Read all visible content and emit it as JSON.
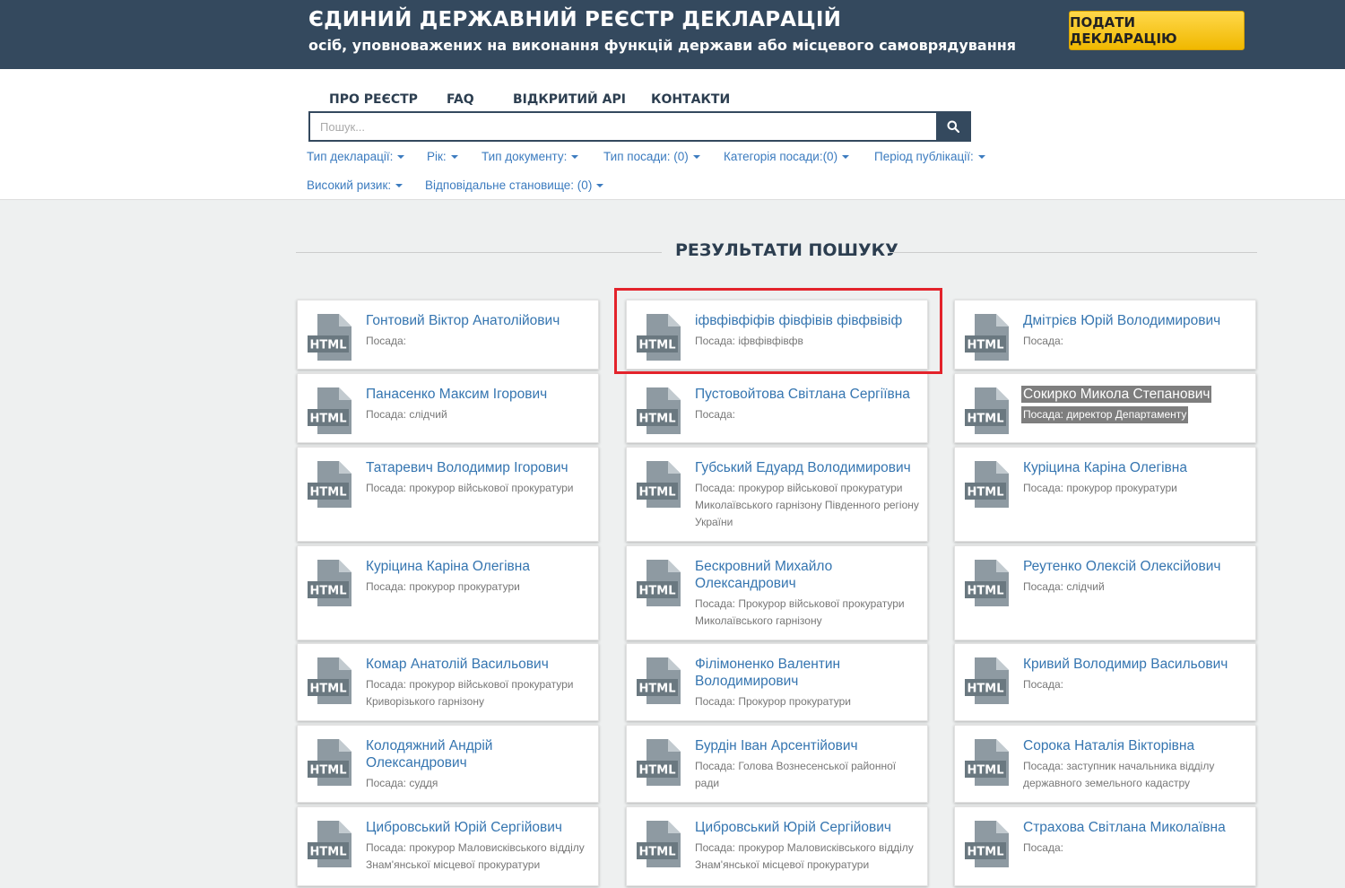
{
  "header": {
    "title": "ЄДИНИЙ ДЕРЖАВНИЙ РЕЄСТР ДЕКЛАРАЦІЙ",
    "subtitle": "осіб, уповноважених на виконання функцій держави або місцевого самоврядування",
    "submit_label": "ПОДАТИ ДЕКЛАРАЦІЮ"
  },
  "nav": [
    "ПРО РЕЄСТР",
    "FAQ",
    "ВІДКРИТИЙ API",
    "КОНТАКТИ"
  ],
  "search": {
    "placeholder": "Пошук...",
    "value": ""
  },
  "filters": [
    "Тип декларації:",
    "Рік:",
    "Тип документу:",
    "Тип посади: (0)",
    "Категорія посади:(0)",
    "Період публікації:",
    "Високий ризик:",
    "Відповідальне становище: (0)"
  ],
  "results_title": "РЕЗУЛЬТАТИ ПОШУКУ",
  "icon_label": "HTML",
  "colors": {
    "header": "#34495e",
    "accent_button": "#f5c518",
    "link": "#3575b0",
    "highlight": "#e3232b"
  },
  "cards": [
    {
      "name": "Гонтовий Віктор Анатолійович",
      "position": "Посада:"
    },
    {
      "name": "іфвфівфіфів фівфівів фівфвівіф",
      "position": "Посада: іфвфівфівфв"
    },
    {
      "name": "Дмітрієв Юрій Володимирович",
      "position": "Посада:"
    },
    {
      "name": "Панасенко Максим Ігорович",
      "position": "Посада: слідчий"
    },
    {
      "name": "Пустовойтова Світлана Сергіївна",
      "position": "Посада:"
    },
    {
      "name": "Сокирко Микола Степанович",
      "position": "Посада: директор Департаменту"
    },
    {
      "name": "Татаревич Володимир Ігорович",
      "position": "Посада: прокурор військової прокуратури"
    },
    {
      "name": "Губський Едуард Володимирович",
      "position": "Посада: прокурор військової прокуратури Миколаївського гарнізону Південного регіону України"
    },
    {
      "name": "Куріцина Каріна Олегівна",
      "position": "Посада: прокурор прокуратури"
    },
    {
      "name": "Куріцина Каріна Олегівна",
      "position": "Посада: прокурор прокуратури"
    },
    {
      "name": "Бескровний Михайло Олександрович",
      "position": "Посада: Прокурор військової прокуратури Миколаївського гарнізону"
    },
    {
      "name": "Реутенко Олексій Олексійович",
      "position": "Посада: слідчий"
    },
    {
      "name": "Комар Анатолій Васильович",
      "position": "Посада: прокурор військової прокуратури Криворізького гарнізону"
    },
    {
      "name": "Філімоненко Валентин Володимирович",
      "position": "Посада: Прокурор прокуратури"
    },
    {
      "name": "Кривий Володимир Васильович",
      "position": "Посада:"
    },
    {
      "name": "Колодяжний Андрій Олександрович",
      "position": "Посада: суддя"
    },
    {
      "name": "Бурдін Іван Арсентійович",
      "position": "Посада: Голова Вознесенської районної ради"
    },
    {
      "name": "Сорока Наталія Вікторівна",
      "position": "Посада: заступник начальника відділу державного земельного кадастру"
    },
    {
      "name": "Цибровський Юрій Сергійович",
      "position": "Посада: прокурор Маловисківського відділу Знам'янської місцевої прокуратури"
    },
    {
      "name": "Цибровський Юрій Сергійович",
      "position": "Посада: прокурор Маловисківського відділу Знам'янської місцевої прокуратури"
    },
    {
      "name": "Страхова Світлана Миколаївна",
      "position": "Посада:"
    }
  ]
}
